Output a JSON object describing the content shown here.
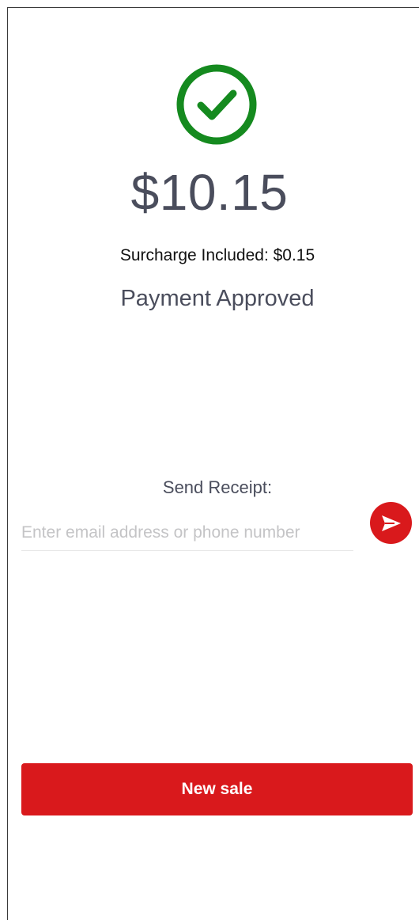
{
  "payment": {
    "amount": "$10.15",
    "surcharge_text": "Surcharge Included: $0.15",
    "status": "Payment Approved",
    "status_icon": "check-circle-icon"
  },
  "receipt": {
    "label": "Send Receipt:",
    "placeholder": "Enter email address or phone number",
    "value": "",
    "send_icon": "send-icon"
  },
  "actions": {
    "new_sale_label": "New sale"
  },
  "colors": {
    "success": "#158a1f",
    "accent": "#d9191c",
    "text_primary": "#4a4d5c",
    "placeholder": "#c4c4c6"
  }
}
